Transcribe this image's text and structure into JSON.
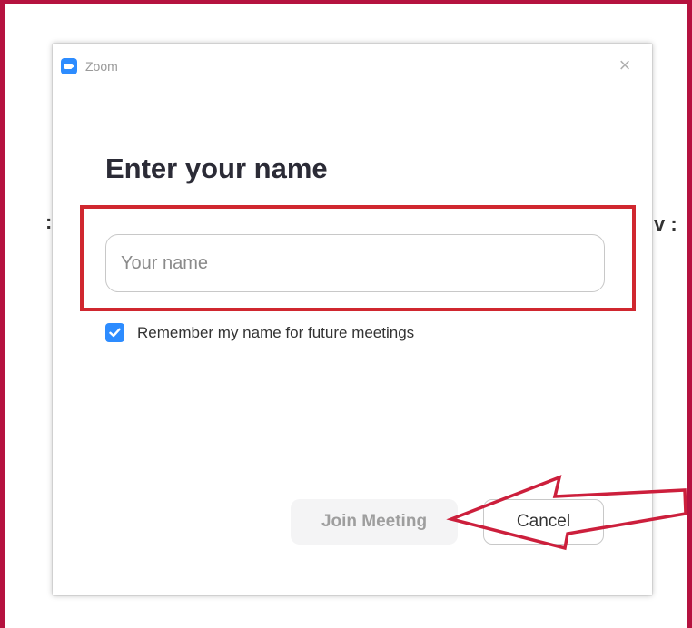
{
  "window": {
    "title": "Zoom",
    "close_glyph": "×"
  },
  "heading": "Enter your name",
  "name_input": {
    "placeholder": "Your name",
    "value": ""
  },
  "remember": {
    "checked": true,
    "label": "Remember my name for future meetings"
  },
  "buttons": {
    "join_label": "Join Meeting",
    "cancel_label": "Cancel"
  },
  "icons": {
    "app": "zoom-camera-icon",
    "close": "close-icon",
    "check": "checkmark-icon"
  },
  "colors": {
    "frame_border": "#b5123f",
    "highlight": "#d0272f",
    "accent": "#2d8cff"
  }
}
